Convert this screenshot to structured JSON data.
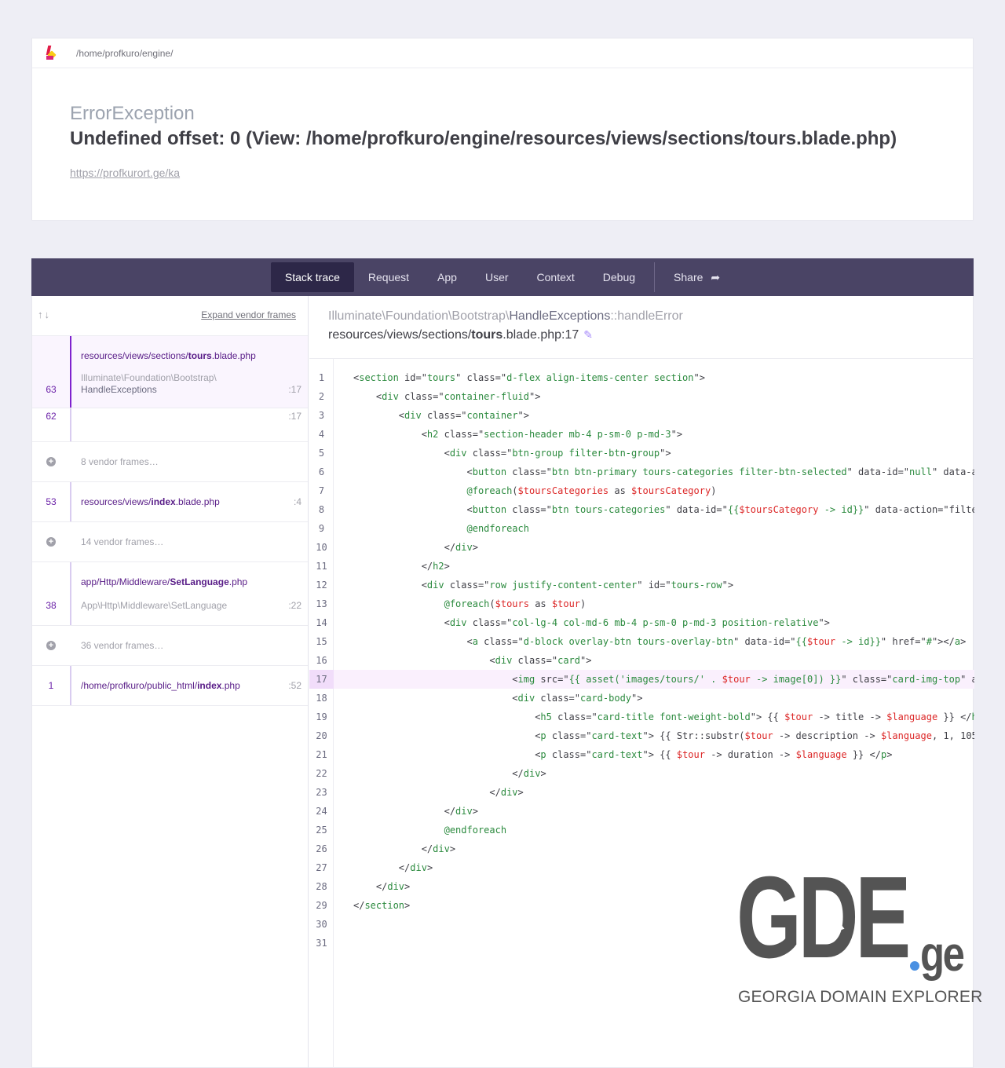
{
  "header": {
    "path": "/home/profkuro/engine/",
    "exception_class": "ErrorException",
    "message": "Undefined offset: 0 (View: /home/profkuro/engine/resources/views/sections/tours.blade.php)",
    "url": "https://profkurort.ge/ka"
  },
  "tabs": {
    "stack_trace": "Stack trace",
    "request": "Request",
    "app": "App",
    "user": "User",
    "context": "Context",
    "debug": "Debug",
    "share": "Share"
  },
  "sidebar": {
    "expand_label": "Expand vendor frames",
    "frames": [
      {
        "number": "63",
        "file_prefix": "resources/views/sections/",
        "file_bold": "tours",
        "file_suffix": ".blade.php",
        "class_line1": "Illuminate\\Foundation\\Bootstrap\\",
        "class_line2": "HandleExceptions",
        "line": ":17"
      },
      {
        "number": "62",
        "line": ":17"
      },
      {
        "vendor": "8 vendor frames…"
      },
      {
        "number": "53",
        "file_prefix": "resources/views/",
        "file_bold": "index",
        "file_suffix": ".blade.php",
        "line": ":4"
      },
      {
        "vendor": "14 vendor frames…"
      },
      {
        "number": "38",
        "file_prefix": "app/Http/Middleware/",
        "file_bold": "SetLanguage",
        "file_suffix": ".php",
        "class_line1": "App\\Http\\Middleware\\SetLanguage",
        "line": ":22"
      },
      {
        "vendor": "36 vendor frames…"
      },
      {
        "number": "1",
        "file_prefix": "/home/profkuro/public_html/",
        "file_bold": "index",
        "file_suffix": ".php",
        "line": ":52"
      }
    ]
  },
  "frame_detail": {
    "class_prefix": "Illuminate\\Foundation\\Bootstrap\\",
    "class_name": "HandleExceptions",
    "method": "::handleError",
    "file_prefix": "resources/views/sections/",
    "file_bold": "tours",
    "file_suffix": ".blade.php:17",
    "highlighted_line": 17
  },
  "code_lines": [
    "<section id=\"tours\" class=\"d-flex align-items-center section\">",
    "    <div class=\"container-fluid\">",
    "        <div class=\"container\">",
    "            <h2 class=\"section-header mb-4 p-sm-0 p-md-3\">",
    "                <div class=\"btn-group filter-btn-group\">",
    "                    <button class=\"btn btn-primary tours-categories filter-btn-selected\" data-id=\"null\" data-a",
    "                    @foreach($toursCategories as $toursCategory)",
    "                    <button class=\"btn tours-categories\" data-id=\"{{$toursCategory -> id}}\" data-action=\"filte",
    "                    @endforeach",
    "                </div>",
    "            </h2>",
    "            <div class=\"row justify-content-center\" id=\"tours-row\">",
    "                @foreach($tours as $tour)",
    "                <div class=\"col-lg-4 col-md-6 mb-4 p-sm-0 p-md-3 position-relative\">",
    "                    <a class=\"d-block overlay-btn tours-overlay-btn\" data-id=\"{{$tour -> id}}\" href=\"#\"></a>",
    "                        <div class=\"card\">",
    "                            <img src=\"{{ asset('images/tours/' . $tour -> image[0]) }}\" class=\"card-img-top\" a",
    "                            <div class=\"card-body\">",
    "                                <h5 class=\"card-title font-weight-bold\"> {{ $tour -> title -> $language }} </h",
    "                                <p class=\"card-text\"> {{ Str::substr($tour -> description -> $language, 1, 105",
    "                                <p class=\"card-text\"> {{ $tour -> duration -> $language }} </p>",
    "                            </div>",
    "                        </div>",
    "                </div>",
    "                @endforeach",
    "            </div>",
    "        </div>",
    "    </div>",
    "</section>",
    "",
    ""
  ],
  "watermark": {
    "main": "GDE",
    "suffix": "ge",
    "subtitle": "GEORGIA DOMAIN EXPLORER"
  },
  "colors": {
    "accent": "#7e22ce",
    "tabbar": "#4a4465",
    "tab_active": "#2d2748"
  }
}
